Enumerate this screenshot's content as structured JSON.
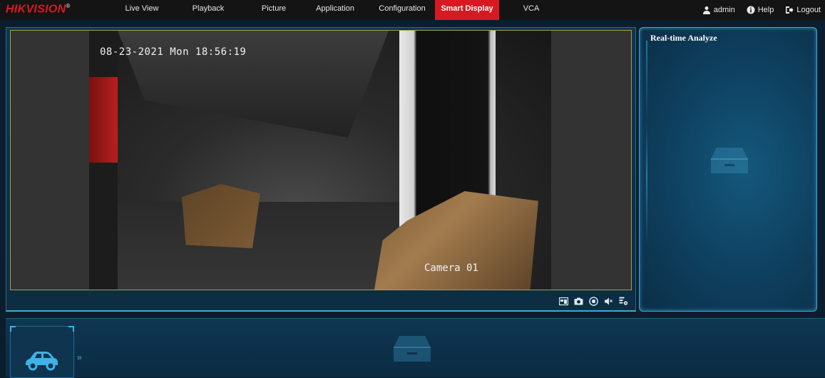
{
  "brand": {
    "logo_text": "HIKVISION",
    "logo_mark": "®"
  },
  "nav": {
    "items": [
      {
        "label": "Live View",
        "active": false
      },
      {
        "label": "Playback",
        "active": false
      },
      {
        "label": "Picture",
        "active": false
      },
      {
        "label": "Application",
        "active": false
      },
      {
        "label": "Configuration",
        "active": false
      },
      {
        "label": "Smart Display",
        "active": true
      },
      {
        "label": "VCA",
        "active": false
      }
    ],
    "user": "admin",
    "help": "Help",
    "logout": "Logout"
  },
  "video": {
    "osd_datetime": "08-23-2021 Mon 18:56:19",
    "osd_camera": "Camera 01",
    "tools": [
      {
        "icon": "window-icon"
      },
      {
        "icon": "camera-icon"
      },
      {
        "icon": "record-icon"
      },
      {
        "icon": "mute-icon"
      },
      {
        "icon": "settings-icon"
      }
    ]
  },
  "analyze": {
    "title": "Real-time Analyze"
  },
  "bottom": {
    "selected": "vehicle"
  },
  "colors": {
    "accent": "#d71a21",
    "panel_border": "#3aa6d6",
    "background": "#0b1e2e"
  }
}
